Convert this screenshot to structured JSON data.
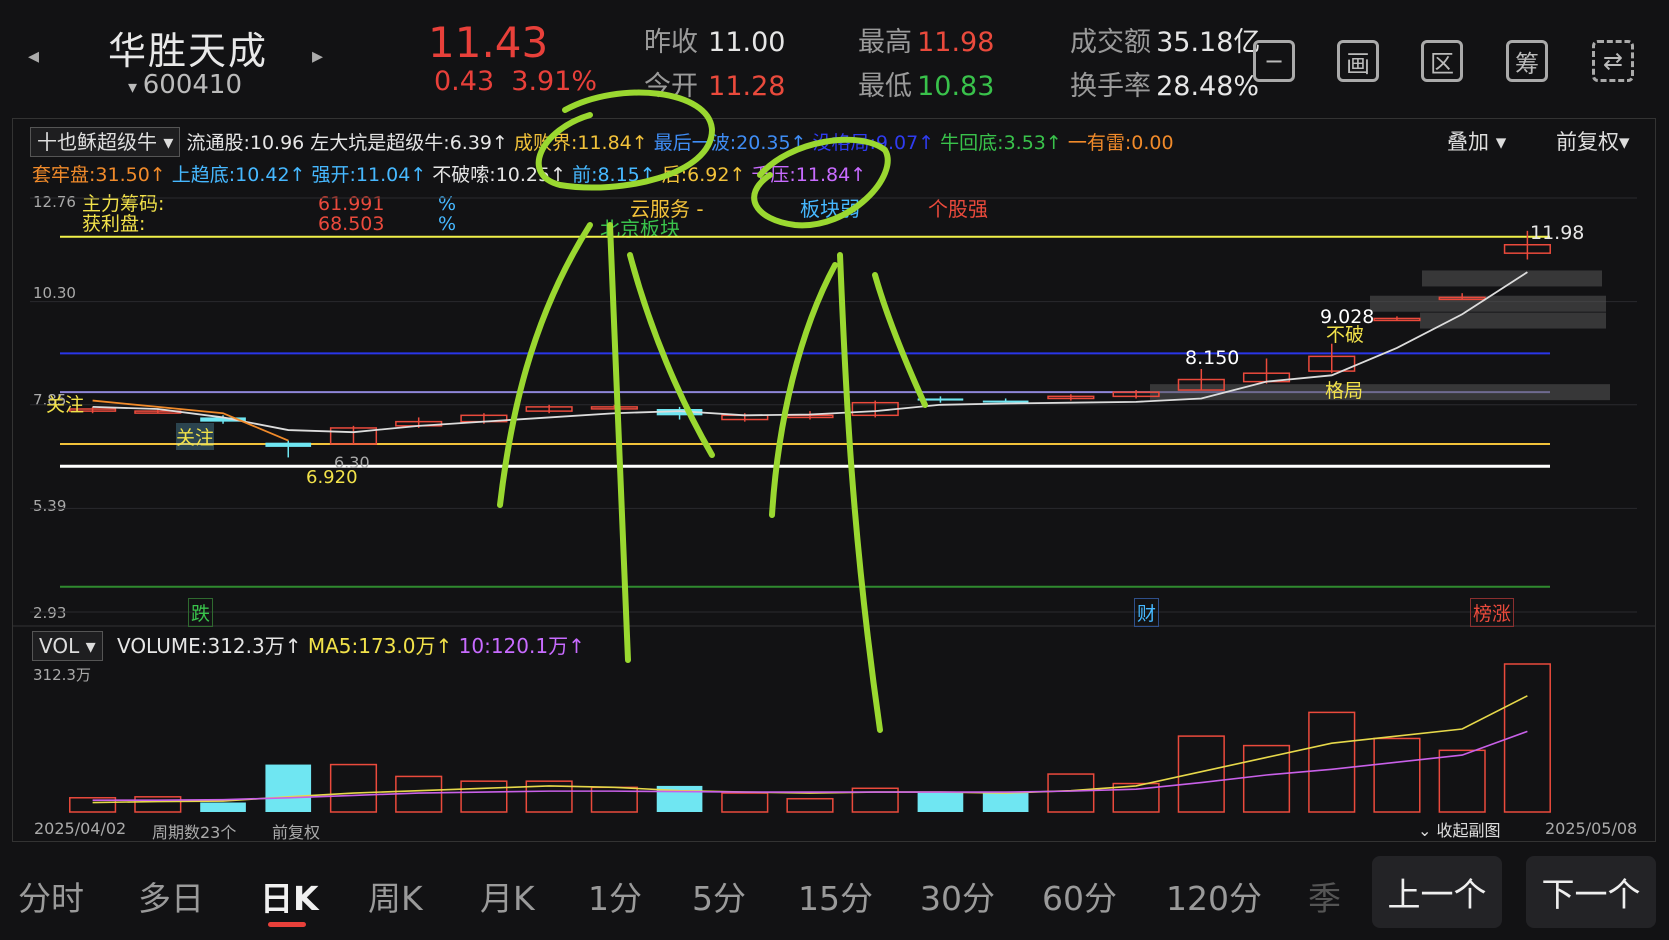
{
  "stock": {
    "name": "华胜天成",
    "code": "600410",
    "price": "11.43",
    "change": "0.43",
    "change_pct": "3.91%"
  },
  "quote": {
    "prev_close_label": "昨收",
    "prev_close": "11.00",
    "open_label": "今开",
    "open": "11.28",
    "high_label": "最高",
    "high": "11.98",
    "low_label": "最低",
    "low": "10.83",
    "amount_label": "成交额",
    "amount": "35.18亿",
    "turnover_label": "换手率",
    "turnover": "28.48%"
  },
  "top_icons": [
    "minus-square-icon",
    "画",
    "区",
    "筹",
    "device-switch-icon"
  ],
  "indicator_row1": {
    "selector": "十也稣超级牛",
    "items": [
      {
        "text": "流通股:10.96",
        "color": "#e6e6e6"
      },
      {
        "text": "左大坑是超级牛:6.39↑",
        "color": "#e6e6e6"
      },
      {
        "text": "成败界:11.84↑",
        "color": "#f2c23a"
      },
      {
        "text": "最后一波:20.35↑",
        "color": "#3f8df5"
      },
      {
        "text": "没格局:9.07↑",
        "color": "#2f3cf0"
      },
      {
        "text": "牛回底:3.53↑",
        "color": "#39c24b"
      },
      {
        "text": "一有雷:0.00",
        "color": "#f08a2a"
      }
    ],
    "overlay": "叠加",
    "adjust": "前复权"
  },
  "indicator_row2": [
    {
      "text": "套牢盘:31.50↑",
      "color": "#f08a2a"
    },
    {
      "text": "上趋底:10.42↑",
      "color": "#46b8ff"
    },
    {
      "text": "强开:11.04↑",
      "color": "#46b8ff"
    },
    {
      "text": "不破嗦:10.25↑",
      "color": "#e6e6e6"
    },
    {
      "text": "前:8.15↑",
      "color": "#46b8ff"
    },
    {
      "text": "后:6.92↑",
      "color": "#f2c23a"
    },
    {
      "text": "千压:11.84↑",
      "color": "#c86bff"
    }
  ],
  "chips": {
    "main_label": "主力筹码:",
    "main_value": "61.991",
    "main_unit": "%",
    "profit_label": "获利盘:",
    "profit_value": "68.503",
    "profit_unit": "%",
    "cloud": "云服务 -",
    "beijing": "北京板块",
    "weak": "板块弱",
    "stock_strong": "个股强"
  },
  "chart_data": {
    "type": "candlestick",
    "y_ticks": [
      "12.76",
      "10.30",
      "7.85",
      "5.39",
      "2.93"
    ],
    "ylim": [
      2.93,
      12.76
    ],
    "candles": [
      {
        "o": 7.75,
        "c": 7.7,
        "h": 7.8,
        "l": 7.65,
        "vol": 0.3,
        "color": "red"
      },
      {
        "o": 7.7,
        "c": 7.7,
        "h": 7.75,
        "l": 7.65,
        "vol": 0.32,
        "color": "red"
      },
      {
        "o": 7.55,
        "c": 7.45,
        "h": 7.6,
        "l": 7.4,
        "vol": 0.2,
        "color": "cyan"
      },
      {
        "o": 6.95,
        "c": 6.85,
        "h": 7.0,
        "l": 6.6,
        "vol": 1.0,
        "color": "cyan"
      },
      {
        "o": 6.92,
        "c": 7.3,
        "h": 7.35,
        "l": 6.92,
        "vol": 1.0,
        "color": "red"
      },
      {
        "o": 7.35,
        "c": 7.45,
        "h": 7.55,
        "l": 7.3,
        "vol": 0.75,
        "color": "red"
      },
      {
        "o": 7.45,
        "c": 7.6,
        "h": 7.65,
        "l": 7.4,
        "vol": 0.65,
        "color": "red"
      },
      {
        "o": 7.7,
        "c": 7.8,
        "h": 7.85,
        "l": 7.65,
        "vol": 0.65,
        "color": "red"
      },
      {
        "o": 7.8,
        "c": 7.8,
        "h": 7.85,
        "l": 7.75,
        "vol": 0.52,
        "color": "red"
      },
      {
        "o": 7.75,
        "c": 7.6,
        "h": 7.8,
        "l": 7.5,
        "vol": 0.55,
        "color": "cyan"
      },
      {
        "o": 7.5,
        "c": 7.6,
        "h": 7.65,
        "l": 7.45,
        "vol": 0.4,
        "color": "red"
      },
      {
        "o": 7.55,
        "c": 7.6,
        "h": 7.7,
        "l": 7.5,
        "vol": 0.28,
        "color": "red"
      },
      {
        "o": 7.6,
        "c": 7.9,
        "h": 7.95,
        "l": 7.55,
        "vol": 0.5,
        "color": "red"
      },
      {
        "o": 8.0,
        "c": 7.95,
        "h": 8.05,
        "l": 7.9,
        "vol": 0.42,
        "color": "cyan"
      },
      {
        "o": 7.95,
        "c": 7.95,
        "h": 8.0,
        "l": 7.9,
        "vol": 0.4,
        "color": "cyan"
      },
      {
        "o": 8.0,
        "c": 8.05,
        "h": 8.1,
        "l": 7.95,
        "vol": 0.8,
        "color": "red"
      },
      {
        "o": 8.05,
        "c": 8.15,
        "h": 8.2,
        "l": 8.0,
        "vol": 0.6,
        "color": "red"
      },
      {
        "o": 8.2,
        "c": 8.45,
        "h": 8.7,
        "l": 8.2,
        "vol": 1.6,
        "color": "red"
      },
      {
        "o": 8.4,
        "c": 8.6,
        "h": 8.95,
        "l": 8.35,
        "vol": 1.4,
        "color": "red"
      },
      {
        "o": 8.65,
        "c": 9.0,
        "h": 9.3,
        "l": 8.6,
        "vol": 2.1,
        "color": "red"
      },
      {
        "o": 9.9,
        "c": 9.9,
        "h": 9.95,
        "l": 9.85,
        "vol": 1.55,
        "color": "red"
      },
      {
        "o": 10.4,
        "c": 10.4,
        "h": 10.5,
        "l": 10.35,
        "vol": 1.3,
        "color": "red"
      },
      {
        "o": 11.45,
        "c": 11.65,
        "h": 11.98,
        "l": 11.3,
        "vol": 3.12,
        "color": "red"
      }
    ],
    "ma_line": [
      7.8,
      7.75,
      7.55,
      7.25,
      7.2,
      7.35,
      7.45,
      7.55,
      7.65,
      7.7,
      7.6,
      7.62,
      7.7,
      7.85,
      7.88,
      7.9,
      7.92,
      8.0,
      8.4,
      8.55,
      9.2,
      10.0,
      11.0
    ],
    "h_lines": [
      {
        "y": 11.84,
        "color": "#f2f24a"
      },
      {
        "y": 9.07,
        "color": "#2a36e8"
      },
      {
        "y": 8.15,
        "color": "#8e86d8"
      },
      {
        "y": 6.92,
        "color": "#f2c23a"
      },
      {
        "y": 6.39,
        "color": "#ffffff"
      },
      {
        "y": 3.53,
        "color": "#2f8a2f"
      }
    ],
    "annotations": {
      "high_mark": "11.98",
      "low_mark": "6.920",
      "low_val": "6.30",
      "level_8150": "8.150",
      "level_9028": "9.028",
      "bu_po": "不破",
      "ge_ju": "格局",
      "guanzhu1": "关注",
      "guanzhu2": "关注",
      "die": "跌",
      "cai": "财",
      "bang": "榜涨"
    },
    "volume": {
      "label": "VOL",
      "value": "VOLUME:312.3万↑",
      "ma5": "MA5:173.0万↑",
      "ma10": "10:120.1万↑",
      "max": "312.3万",
      "ma5_line": [
        0.2,
        0.22,
        0.23,
        0.32,
        0.4,
        0.45,
        0.5,
        0.55,
        0.52,
        0.45,
        0.42,
        0.4,
        0.42,
        0.42,
        0.4,
        0.45,
        0.55,
        0.85,
        1.15,
        1.45,
        1.6,
        1.75,
        2.45
      ],
      "ma10_line": [
        0.25,
        0.25,
        0.26,
        0.3,
        0.35,
        0.4,
        0.42,
        0.44,
        0.44,
        0.43,
        0.42,
        0.42,
        0.42,
        0.42,
        0.42,
        0.44,
        0.48,
        0.62,
        0.78,
        0.9,
        1.05,
        1.2,
        1.7
      ]
    },
    "footer": {
      "start": "2025/04/02",
      "periods": "周期数23个",
      "adjust": "前复权",
      "collapse": "收起副图",
      "end": "2025/05/08"
    }
  },
  "tabs": [
    "分时",
    "多日",
    "日K",
    "周K",
    "月K",
    "1分",
    "5分",
    "15分",
    "30分",
    "60分",
    "120分",
    "季"
  ],
  "active_tab": "日K",
  "nav": {
    "prev": "上一个",
    "next": "下一个"
  }
}
